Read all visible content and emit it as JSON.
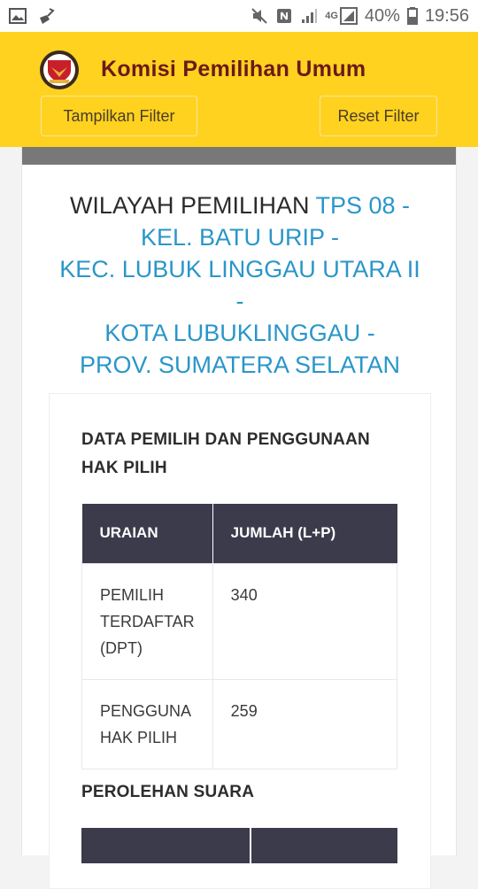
{
  "status_bar": {
    "battery_percent": "40%",
    "time": "19:56",
    "network": "4G",
    "icons": [
      "image-icon",
      "broom-icon",
      "mute-icon",
      "nfc-icon",
      "signal-icon",
      "lte-signal-icon",
      "battery-icon"
    ]
  },
  "header": {
    "title": "Komisi Pemilihan Umum",
    "logo": "kpu-logo",
    "filter_button": "Tampilkan Filter",
    "reset_button": "Reset Filter"
  },
  "region": {
    "label": "WILAYAH PEMILIHAN",
    "lines": [
      "TPS 08 -",
      "KEL. BATU URIP -",
      "KEC. LUBUK LINGGAU UTARA II",
      "-",
      "KOTA LUBUKLINGGAU -",
      "PROV. SUMATERA SELATAN"
    ]
  },
  "voter_section": {
    "title_line1": "DATA PEMILIH DAN PENGGUNAAN",
    "title_line2": "HAK PILIH",
    "columns": [
      "URAIAN",
      "JUMLAH (L+P)"
    ],
    "rows": [
      {
        "label_lines": [
          "PEMILIH",
          "TERDAFTAR",
          "(DPT)"
        ],
        "value": "340"
      },
      {
        "label_lines": [
          "PENGGUNA",
          "HAK PILIH"
        ],
        "value": "259"
      }
    ]
  },
  "votes_section": {
    "title": "PEROLEHAN SUARA"
  },
  "colors": {
    "appbar": "#ffd21f",
    "title": "#6b1a1a",
    "link_blue": "#2a96c9",
    "table_header": "#3b3b4c"
  }
}
